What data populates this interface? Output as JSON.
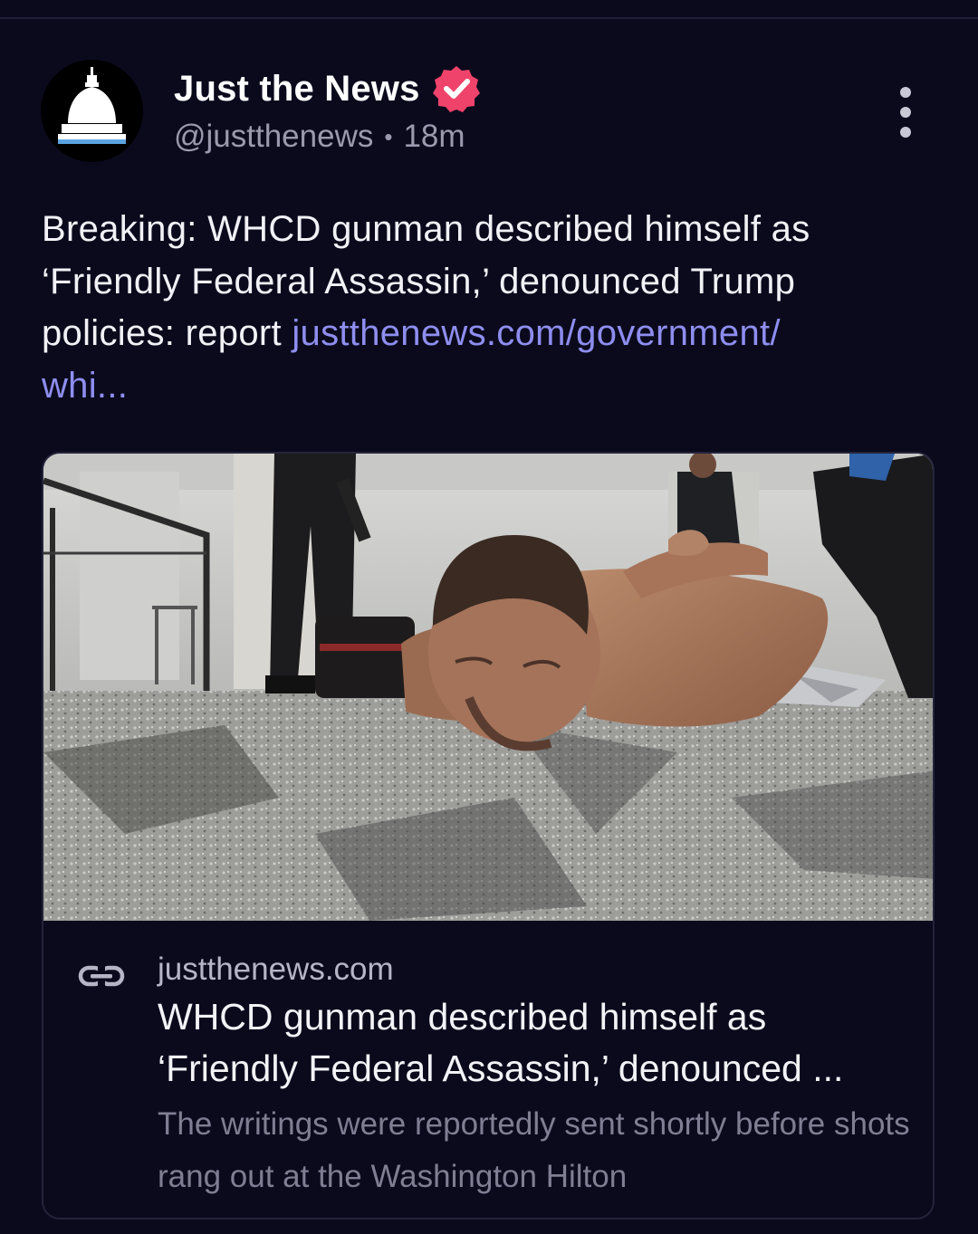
{
  "post": {
    "author": {
      "display_name": "Just the News",
      "handle": "@justthenews",
      "time_ago": "18m",
      "separator": "•",
      "avatar_icon": "capitol-dome-icon",
      "verified_icon": "verified-badge-icon"
    },
    "text": "Breaking: WHCD gunman described himself as ‘Friendly Federal Assassin,’ denounced Trump policies: report ",
    "link_line1": "justthenews.com/government/",
    "link_line2": "whi...",
    "more_icon": "more-vertical-icon"
  },
  "link_card": {
    "domain": "justthenews.com",
    "title_line1": "WHCD gunman described himself as",
    "title_line2": "‘Friendly Federal Assassin,’ denounced ...",
    "description": "The writings were reportedly sent shortly before shots rang out at the Washington Hilton",
    "link_icon": "link-icon"
  },
  "colors": {
    "background": "#0b0a1d",
    "link": "#8e8ef0",
    "verified_badge": "#f0436b",
    "secondary_text": "#9a99ad"
  }
}
